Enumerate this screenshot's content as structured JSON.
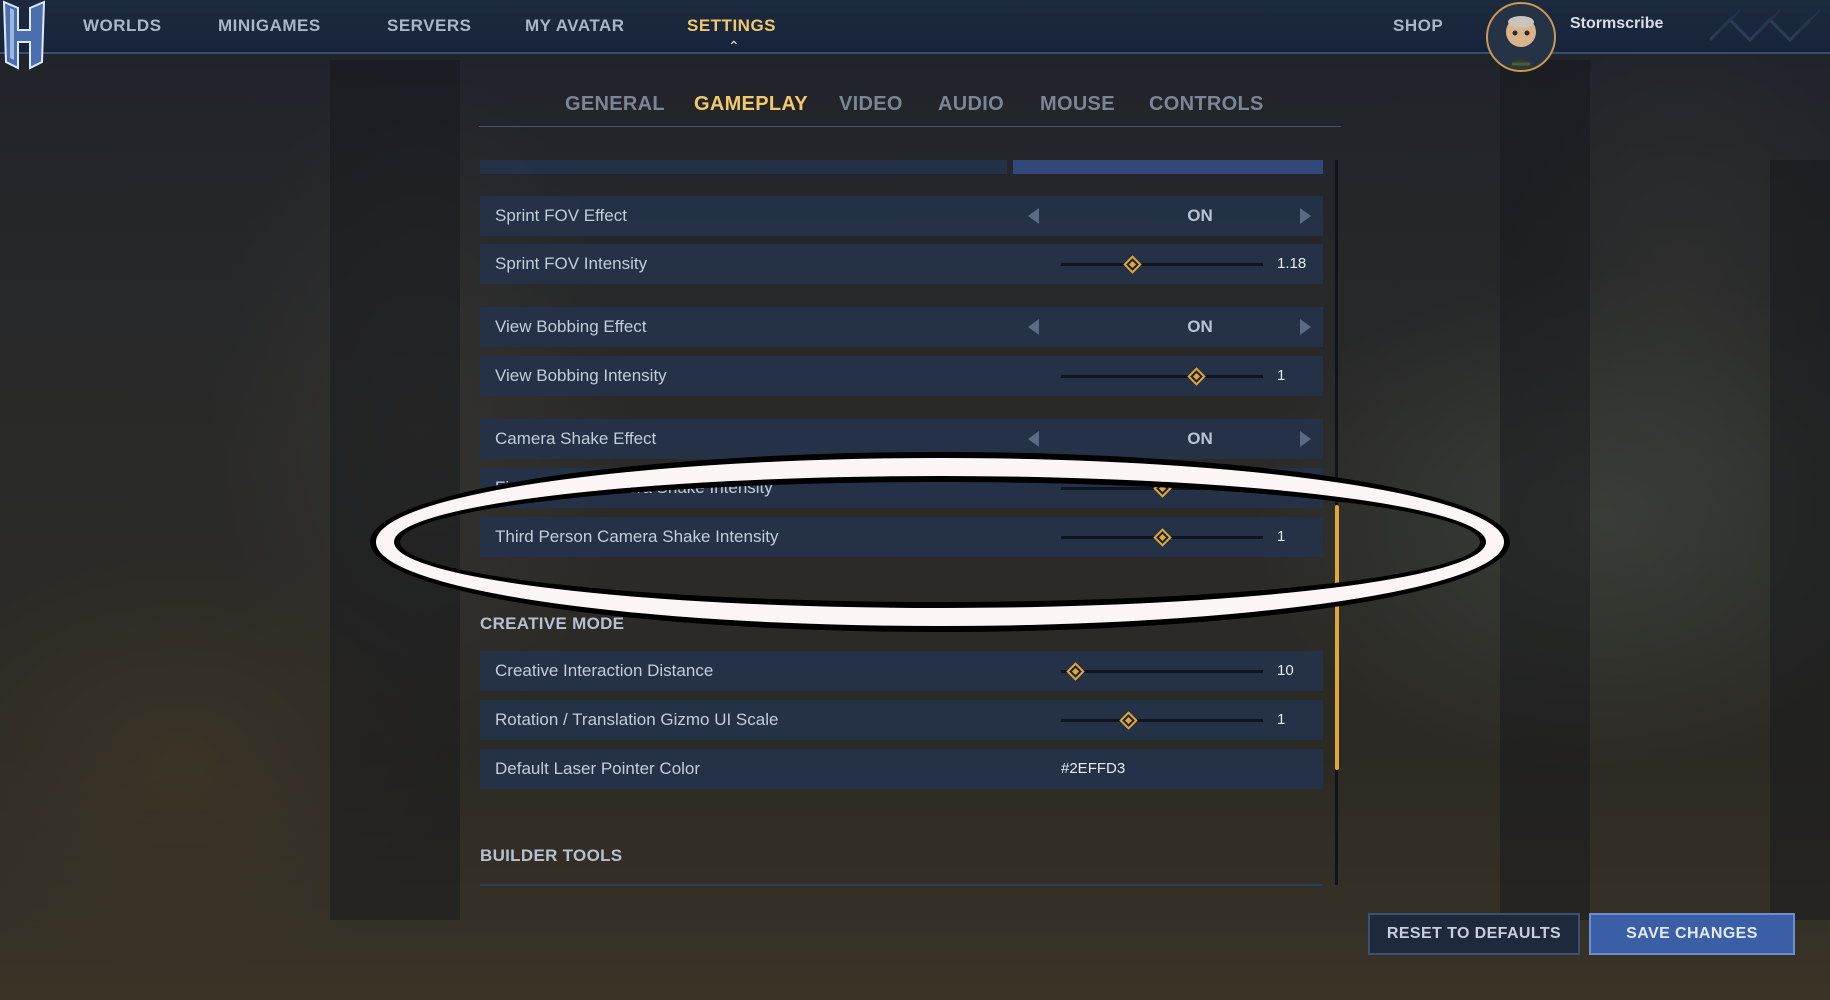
{
  "nav": {
    "items": [
      {
        "label": "WORLDS",
        "active": false
      },
      {
        "label": "MINIGAMES",
        "active": false
      },
      {
        "label": "SERVERS",
        "active": false
      },
      {
        "label": "MY AVATAR",
        "active": false
      },
      {
        "label": "SETTINGS",
        "active": true
      }
    ],
    "shop_label": "SHOP",
    "username": "Stormscribe"
  },
  "tabs": [
    {
      "label": "GENERAL",
      "active": false
    },
    {
      "label": "GAMEPLAY",
      "active": true
    },
    {
      "label": "VIDEO",
      "active": false
    },
    {
      "label": "AUDIO",
      "active": false
    },
    {
      "label": "MOUSE",
      "active": false
    },
    {
      "label": "CONTROLS",
      "active": false
    }
  ],
  "settings": {
    "sprint_fov_effect": {
      "label": "Sprint FOV Effect",
      "value": "ON"
    },
    "sprint_fov_intensity": {
      "label": "Sprint FOV Intensity",
      "value": "1.18",
      "level": 0.35
    },
    "view_bobbing_effect": {
      "label": "View Bobbing Effect",
      "value": "ON"
    },
    "view_bobbing_intensity": {
      "label": "View Bobbing Intensity",
      "value": "1",
      "level": 0.67
    },
    "camera_shake_effect": {
      "label": "Camera Shake Effect",
      "value": "ON"
    },
    "first_person_shake_intensity": {
      "label": "First Person Camera Shake Intensity",
      "value": "1",
      "level": 0.5
    },
    "third_person_shake_intensity": {
      "label": "Third Person Camera Shake Intensity",
      "value": "1",
      "level": 0.5
    }
  },
  "creative": {
    "section_title": "CREATIVE MODE",
    "interaction_distance": {
      "label": "Creative Interaction Distance",
      "value": "10",
      "level": 0.07
    },
    "gizmo_scale": {
      "label": "Rotation / Translation Gizmo UI Scale",
      "value": "1",
      "level": 0.33
    },
    "laser_color": {
      "label": "Default Laser Pointer Color",
      "value": "#2EFFD3"
    }
  },
  "builder": {
    "section_title": "BUILDER TOOLS"
  },
  "buttons": {
    "reset_label": "RESET TO DEFAULTS",
    "save_label": "SAVE CHANGES"
  },
  "colors": {
    "accent": "#f1c86a",
    "slider_thumb": "#e0a63c",
    "row_bg": "#24324a",
    "save_button": "#3b5fa6"
  },
  "icons": [
    "hytale-logo-icon",
    "chevron-up-icon",
    "arrow-left-icon",
    "arrow-right-icon",
    "slider-thumb-icon"
  ]
}
